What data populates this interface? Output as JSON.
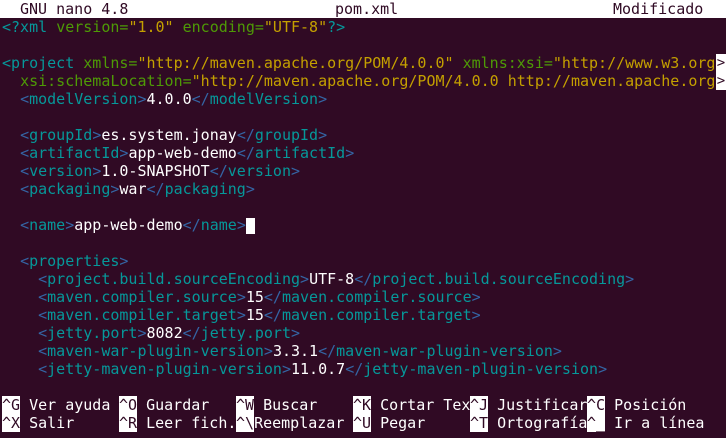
{
  "titlebar": {
    "app": "GNU nano 4.8",
    "filename": "pom.xml",
    "status": "Modificado"
  },
  "editor": {
    "xml_decl": {
      "open": "<?xml",
      "version_attr": "version=",
      "version_val": "\"1.0\"",
      "encoding_attr": "encoding=",
      "encoding_val": "\"UTF-8\"",
      "close": "?>"
    },
    "project_line": {
      "open": "<project",
      "xmlns_attr": "xmlns=",
      "xmlns_val": "\"http://maven.apache.org/POM/4.0.0\"",
      "xsi_attr": "xmlns:xsi=",
      "xsi_val": "\"http://www.w3.org"
    },
    "schema_line": {
      "attr": "xsi:schemaLocation=",
      "val": "\"http://maven.apache.org/POM/4.0.0 http://maven.apache.org"
    },
    "elements": {
      "modelVersion": {
        "tag": "modelVersion",
        "value": "4.0.0"
      },
      "groupId": {
        "tag": "groupId",
        "value": "es.system.jonay"
      },
      "artifactId": {
        "tag": "artifactId",
        "value": "app-web-demo"
      },
      "version": {
        "tag": "version",
        "value": "1.0-SNAPSHOT"
      },
      "packaging": {
        "tag": "packaging",
        "value": "war"
      },
      "name": {
        "tag": "name",
        "value": "app-web-demo"
      },
      "properties": {
        "tag": "properties"
      },
      "encoding": {
        "tag": "project.build.sourceEncoding",
        "value": "UTF-8"
      },
      "compiler_source": {
        "tag": "maven.compiler.source",
        "value": "15"
      },
      "compiler_target": {
        "tag": "maven.compiler.target",
        "value": "15"
      },
      "jetty_port": {
        "tag": "jetty.port",
        "value": "8082"
      },
      "war_plugin": {
        "tag": "maven-war-plugin-version",
        "value": "3.3.1"
      },
      "jetty_plugin": {
        "tag": "jetty-maven-plugin-version",
        "value": "11.0.7"
      }
    },
    "overflow_marker": ">"
  },
  "shortcuts": {
    "row1": [
      {
        "key": "^G",
        "label": "Ver ayuda"
      },
      {
        "key": "^O",
        "label": "Guardar"
      },
      {
        "key": "^W",
        "label": "Buscar"
      },
      {
        "key": "^K",
        "label": "Cortar Tex"
      },
      {
        "key": "^J",
        "label": "Justificar"
      },
      {
        "key": "^C",
        "label": "Posición"
      }
    ],
    "row2": [
      {
        "key": "^X",
        "label": "Salir"
      },
      {
        "key": "^R",
        "label": "Leer fich."
      },
      {
        "key": "^\\",
        "label": "Reemplazar"
      },
      {
        "key": "^U",
        "label": "Pegar"
      },
      {
        "key": "^T",
        "label": "Ortografía"
      },
      {
        "key": "^_",
        "label": "Ir a línea"
      }
    ]
  }
}
